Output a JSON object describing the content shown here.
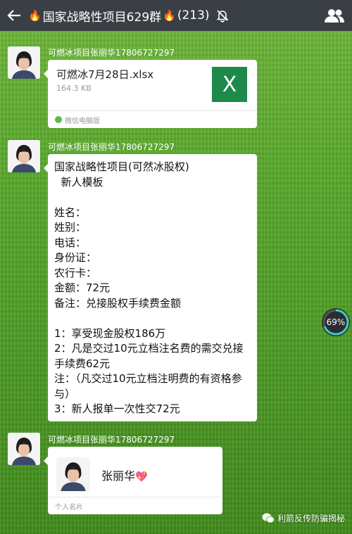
{
  "header": {
    "group_name": "国家战略性项目629群",
    "member_count": "(213)",
    "icons": {
      "back": "back-arrow-icon",
      "mute": "mute-bell-icon",
      "contacts": "group-members-icon"
    }
  },
  "messages": [
    {
      "sender": "可燃冰项目张丽华17806727297",
      "type": "file",
      "file_name": "可燃冰7月28日.xlsx",
      "file_size": "164.3 KB",
      "file_icon_letter": "X",
      "source": "微信电脑版"
    },
    {
      "sender": "可燃冰项目张丽华17806727297",
      "type": "text",
      "text": "国家战略性项目(可然冰股权)\n  新人模板\n\n姓名：\n姓别：\n电话：\n身份证：\n农行卡：\n金额：72元\n备注：兑接股权手续费金额\n\n1：享受现金股权186万\n2：凡是交过10元立档注名费的需交兑接手续费62元\n注：（凡交过10元立档注明费的有资格参与）\n3：新人报单一次性交72元"
    },
    {
      "sender": "可燃冰项目张丽华17806727297",
      "type": "contact_card",
      "card_name": "张丽华",
      "card_label": "个人名片"
    }
  ],
  "overlay": {
    "progress_percent": 69,
    "progress_text": "69%"
  },
  "watermark": {
    "text": "利箭反传防骗揭秘"
  },
  "colors": {
    "topbar": "#3a3f45",
    "excel_green": "#1d8a4c",
    "accent_fire": "#ff7a1a"
  }
}
